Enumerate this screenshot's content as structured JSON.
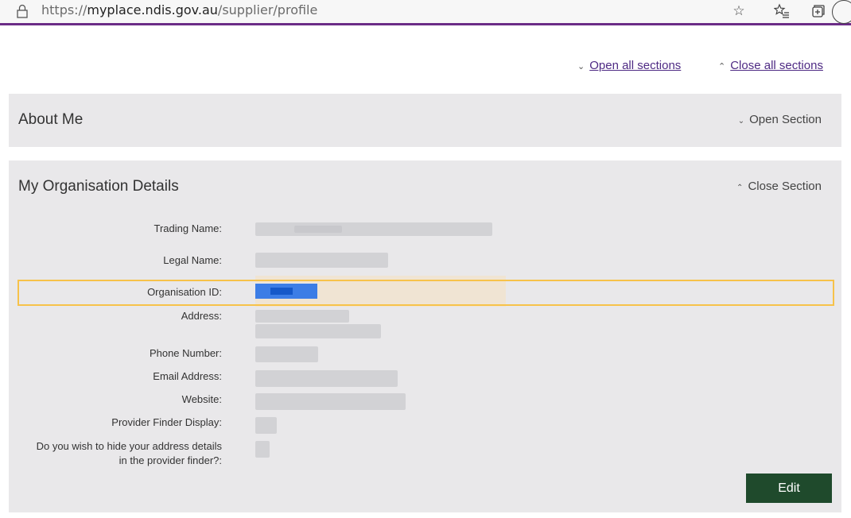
{
  "browser": {
    "url_scheme": "https://",
    "url_host": "myplace.ndis.gov.au",
    "url_path": "/supplier/profile"
  },
  "page": {
    "open_all_label": "Open all sections",
    "close_all_label": "Close all sections"
  },
  "about_me": {
    "title": "About Me",
    "toggle_label": "Open Section"
  },
  "org_details": {
    "title": "My Organisation Details",
    "toggle_label": "Close Section",
    "fields": {
      "trading_name": "Trading Name:",
      "legal_name": "Legal Name:",
      "organisation_id": "Organisation ID:",
      "address": "Address:",
      "phone": "Phone Number:",
      "email": "Email Address:",
      "website": "Website:",
      "provider_finder_display": "Provider Finder Display:",
      "hide_address_line1": "Do you wish to hide your address details",
      "hide_address_line2": "in the provider finder?:"
    },
    "edit_label": "Edit"
  }
}
